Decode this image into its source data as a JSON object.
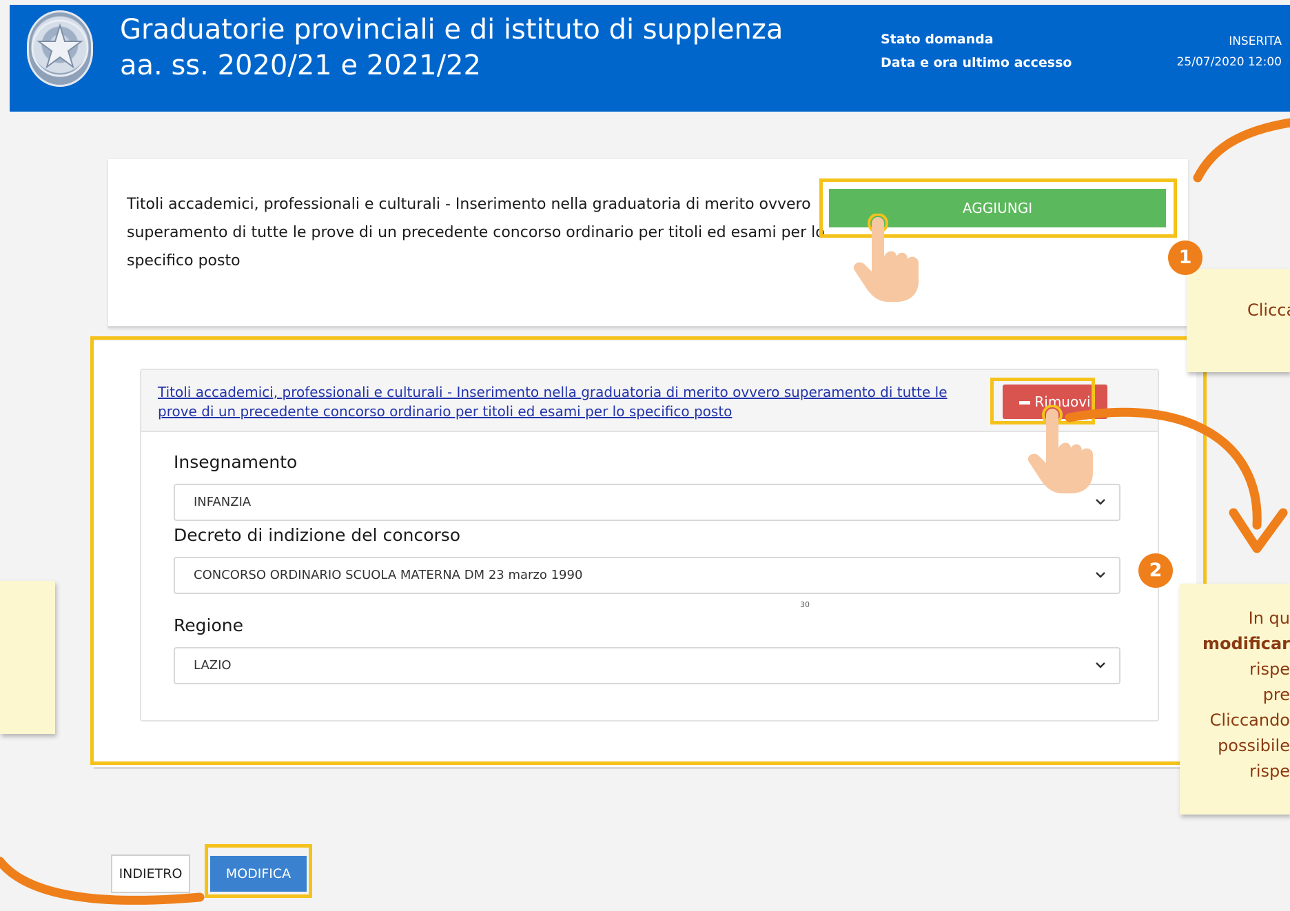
{
  "header": {
    "title_line1": "Graduatorie provinciali e di istituto di supplenza",
    "title_line2": "aa. ss. 2020/21 e 2021/22",
    "status_label": "Stato domanda",
    "status_value": "INSERITA",
    "last_access_label": "Data e ora ultimo accesso",
    "last_access_value": "25/07/2020 12:00"
  },
  "card1": {
    "text": "Titoli accademici, professionali e culturali - Inserimento nella graduatoria di merito ovvero superamento di tutte le prove di un precedente concorso ordinario per titoli ed esami per lo specifico posto",
    "add_button": "AGGIUNGI"
  },
  "panel": {
    "link_text": "Titoli accademici, professionali e culturali - Inserimento nella graduatoria di merito ovvero superamento di tutte le prove di un precedente concorso ordinario per titoli ed esami per lo specifico posto",
    "remove_button": "Rimuovi",
    "fields": {
      "insegnamento_label": "Insegnamento",
      "insegnamento_value": "INFANZIA",
      "decreto_label": "Decreto di indizione del concorso",
      "decreto_value": "CONCORSO ORDINARIO SCUOLA MATERNA DM 23 marzo 1990",
      "regione_label": "Regione",
      "regione_value": "LAZIO"
    },
    "tiny_number": "30"
  },
  "footer": {
    "back_button": "INDIETRO",
    "edit_button": "MODIFICA"
  },
  "annotations": {
    "badge1": "1",
    "badge2": "2",
    "note1_text": "Clicca",
    "note2_line1": "In qu",
    "note2_line2_bold": "modificar",
    "note2_line3": "rispe",
    "note2_line4": "pre",
    "note2_line5": "Cliccando",
    "note2_line6": "possibile",
    "note2_line7": "rispe"
  },
  "colors": {
    "header_bg": "#0066cc",
    "highlight": "#f5c21b",
    "add_button": "#5cb85c",
    "remove_button": "#d9534f",
    "edit_button": "#3a82d0",
    "annotation_orange": "#ef7f1a",
    "note_bg": "#fdf7cf"
  }
}
